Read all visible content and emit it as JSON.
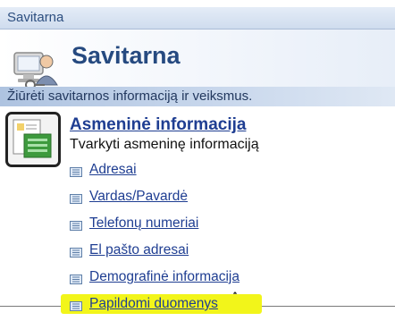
{
  "topbar": {
    "title": "Savitarna"
  },
  "header": {
    "title": "Savitarna",
    "icon": "self-service-icon"
  },
  "description": {
    "text": "Žiūrėti savitarnos informaciją ir veiksmus."
  },
  "section": {
    "title": "Asmeninė informacija",
    "subtitle": "Tvarkyti asmeninę informaciją",
    "icon": "personal-info-folder-icon",
    "links": [
      {
        "label": "Adresai",
        "highlighted": false
      },
      {
        "label": "Vardas/Pavardė",
        "highlighted": false
      },
      {
        "label": "Telefonų numeriai",
        "highlighted": false
      },
      {
        "label": "El pašto adresai",
        "highlighted": false
      },
      {
        "label": "Demografinė informacija",
        "highlighted": false
      },
      {
        "label": "Papildomi duomenys",
        "highlighted": true
      }
    ]
  },
  "colors": {
    "highlight": "#f2f51a",
    "link": "#1f3e92",
    "desc_bar": "#c8d7ec"
  }
}
